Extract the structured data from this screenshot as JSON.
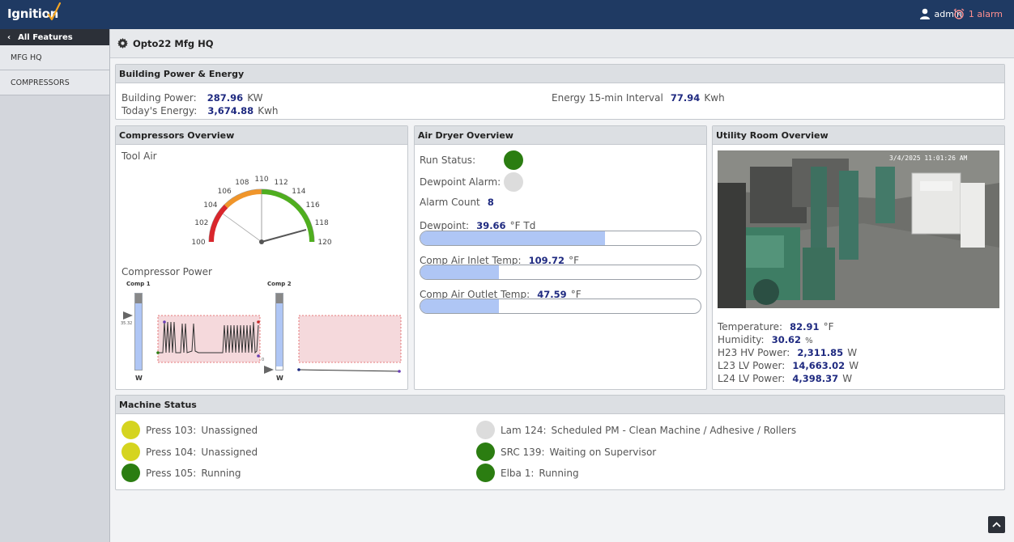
{
  "header": {
    "logo_text": "Ignition",
    "user_label": "admin",
    "alarm_label": "1 alarm",
    "icons": [
      "user-icon",
      "alarm-clock-icon"
    ]
  },
  "sidebar": {
    "back_label": "All Features",
    "items": [
      {
        "label": "MFG HQ"
      },
      {
        "label": "COMPRESSORS"
      }
    ]
  },
  "breadcrumb": {
    "title": "Opto22 Mfg HQ",
    "icon": "gear-icon"
  },
  "building": {
    "title": "Building Power & Energy",
    "power_label": "Building Power:",
    "power_value": "287.96",
    "power_unit": "KW",
    "energy_label": "Today's Energy:",
    "energy_value": "3,674.88",
    "energy_unit": "Kwh",
    "interval_label": "Energy 15-min Interval",
    "interval_value": "77.94",
    "interval_unit": "Kwh"
  },
  "compressors": {
    "title": "Compressors Overview",
    "tool_air_label": "Tool Air",
    "gauge": {
      "min": 100,
      "max": 120,
      "value": 118.3,
      "ticks": [
        "100",
        "102",
        "104",
        "106",
        "108",
        "110",
        "112",
        "114",
        "116",
        "118",
        "120"
      ],
      "bands": [
        {
          "from": 100,
          "to": 105,
          "color": "#d9262c"
        },
        {
          "from": 105,
          "to": 110,
          "color": "#f0952a"
        },
        {
          "from": 110,
          "to": 120,
          "color": "#4fae1f"
        }
      ]
    },
    "power_label": "Compressor Power",
    "comp1_label": "Comp 1",
    "comp2_label": "Comp 2",
    "comp1_readout": "35.32",
    "comp2_readout": "0",
    "unit_label": "W"
  },
  "air_dryer": {
    "title": "Air Dryer Overview",
    "run_status_label": "Run Status:",
    "run_status_color": "#2b7d11",
    "dewpoint_alarm_label": "Dewpoint Alarm:",
    "dewpoint_alarm_color": "#dcdcdc",
    "alarm_count_label": "Alarm Count",
    "alarm_count_value": "8",
    "dewpoint_label": "Dewpoint:",
    "dewpoint_value": "39.66",
    "dewpoint_unit": "°F Td",
    "dewpoint_fill": 0.66,
    "inlet_label": "Comp Air Inlet Temp:",
    "inlet_value": "109.72",
    "inlet_unit": "°F",
    "inlet_fill": 0.28,
    "outlet_label": "Comp Air Outlet Temp:",
    "outlet_value": "47.59",
    "outlet_unit": "°F",
    "outlet_fill": 0.28
  },
  "utility": {
    "title": "Utility Room Overview",
    "camera_timestamp": "3/4/2025 11:01:26 AM",
    "temp_label": "Temperature:",
    "temp_value": "82.91",
    "temp_unit": "°F",
    "humidity_label": "Humidity:",
    "humidity_value": "30.62",
    "humidity_unit": "%",
    "h23_label": "H23 HV Power:",
    "h23_value": "2,311.85",
    "h23_unit": "W",
    "l23_label": "L23 LV Power:",
    "l23_value": "14,663.02",
    "l23_unit": "W",
    "l24_label": "L24 LV Power:",
    "l24_value": "4,398.37",
    "l24_unit": "W"
  },
  "machine_status": {
    "title": "Machine Status",
    "items": [
      {
        "name": "Press 103:",
        "status": "Unassigned",
        "color": "#d5d41f"
      },
      {
        "name": "Press 104:",
        "status": "Unassigned",
        "color": "#d5d41f"
      },
      {
        "name": "Press 105:",
        "status": "Running",
        "color": "#2b7d11"
      },
      {
        "name": "Lam 124:",
        "status": "Scheduled PM - Clean Machine / Adhesive / Rollers",
        "color": "#dcdcdc"
      },
      {
        "name": "SRC 139:",
        "status": "Waiting on Supervisor",
        "color": "#2b7d11"
      },
      {
        "name": "Elba 1:",
        "status": "Running",
        "color": "#2b7d11"
      }
    ]
  }
}
